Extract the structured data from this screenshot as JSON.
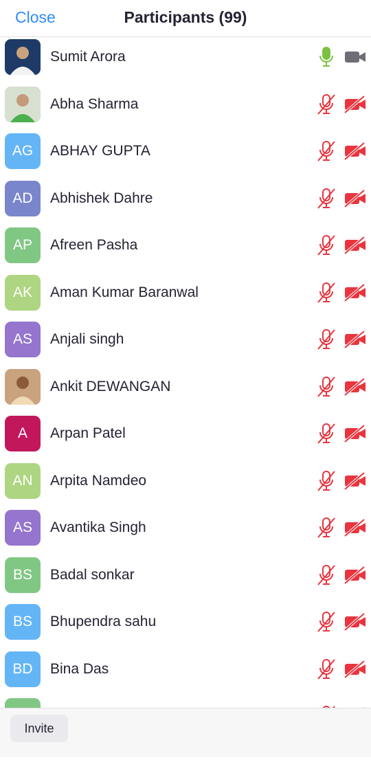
{
  "header": {
    "close_label": "Close",
    "title": "Participants (99)"
  },
  "participants": [
    {
      "name": "Sumit Arora",
      "initials": "",
      "photo": true,
      "avatar_color": "#2b3a57",
      "mic": "on",
      "video": "off-gray"
    },
    {
      "name": "Abha Sharma",
      "initials": "",
      "photo": true,
      "avatar_color": "#a9b99a",
      "mic": "muted",
      "video": "stopped"
    },
    {
      "name": "ABHAY GUPTA",
      "initials": "AG",
      "photo": false,
      "avatar_color": "#64b5f6",
      "mic": "muted",
      "video": "stopped"
    },
    {
      "name": "Abhishek Dahre",
      "initials": "AD",
      "photo": false,
      "avatar_color": "#7986cb",
      "mic": "muted",
      "video": "stopped"
    },
    {
      "name": "Afreen Pasha",
      "initials": "AP",
      "photo": false,
      "avatar_color": "#81c784",
      "mic": "muted",
      "video": "stopped"
    },
    {
      "name": "Aman Kumar Baranwal",
      "initials": "AK",
      "photo": false,
      "avatar_color": "#aed581",
      "mic": "muted",
      "video": "stopped"
    },
    {
      "name": "Anjali singh",
      "initials": "AS",
      "photo": false,
      "avatar_color": "#9575cd",
      "mic": "muted",
      "video": "stopped"
    },
    {
      "name": "Ankit DEWANGAN",
      "initials": "",
      "photo": true,
      "avatar_color": "#b08a6a",
      "mic": "muted",
      "video": "stopped"
    },
    {
      "name": "Arpan Patel",
      "initials": "A",
      "photo": false,
      "avatar_color": "#c2185b",
      "mic": "muted",
      "video": "stopped"
    },
    {
      "name": "Arpita Namdeo",
      "initials": "AN",
      "photo": false,
      "avatar_color": "#aed581",
      "mic": "muted",
      "video": "stopped"
    },
    {
      "name": "Avantika Singh",
      "initials": "AS",
      "photo": false,
      "avatar_color": "#9575cd",
      "mic": "muted",
      "video": "stopped"
    },
    {
      "name": "Badal sonkar",
      "initials": "BS",
      "photo": false,
      "avatar_color": "#81c784",
      "mic": "muted",
      "video": "stopped"
    },
    {
      "name": "Bhupendra sahu",
      "initials": "BS",
      "photo": false,
      "avatar_color": "#64b5f6",
      "mic": "muted",
      "video": "stopped"
    },
    {
      "name": "Bina Das",
      "initials": "BD",
      "photo": false,
      "avatar_color": "#64b5f6",
      "mic": "muted",
      "video": "stopped"
    },
    {
      "name": "",
      "initials": "",
      "photo": false,
      "avatar_color": "#81c784",
      "mic": "muted",
      "video": "stopped"
    }
  ],
  "footer": {
    "invite_label": "Invite"
  },
  "colors": {
    "accent": "#2d8cff",
    "muted_red": "#e8353f",
    "mic_on_green": "#7ac143",
    "video_gray": "#6e6e76"
  }
}
